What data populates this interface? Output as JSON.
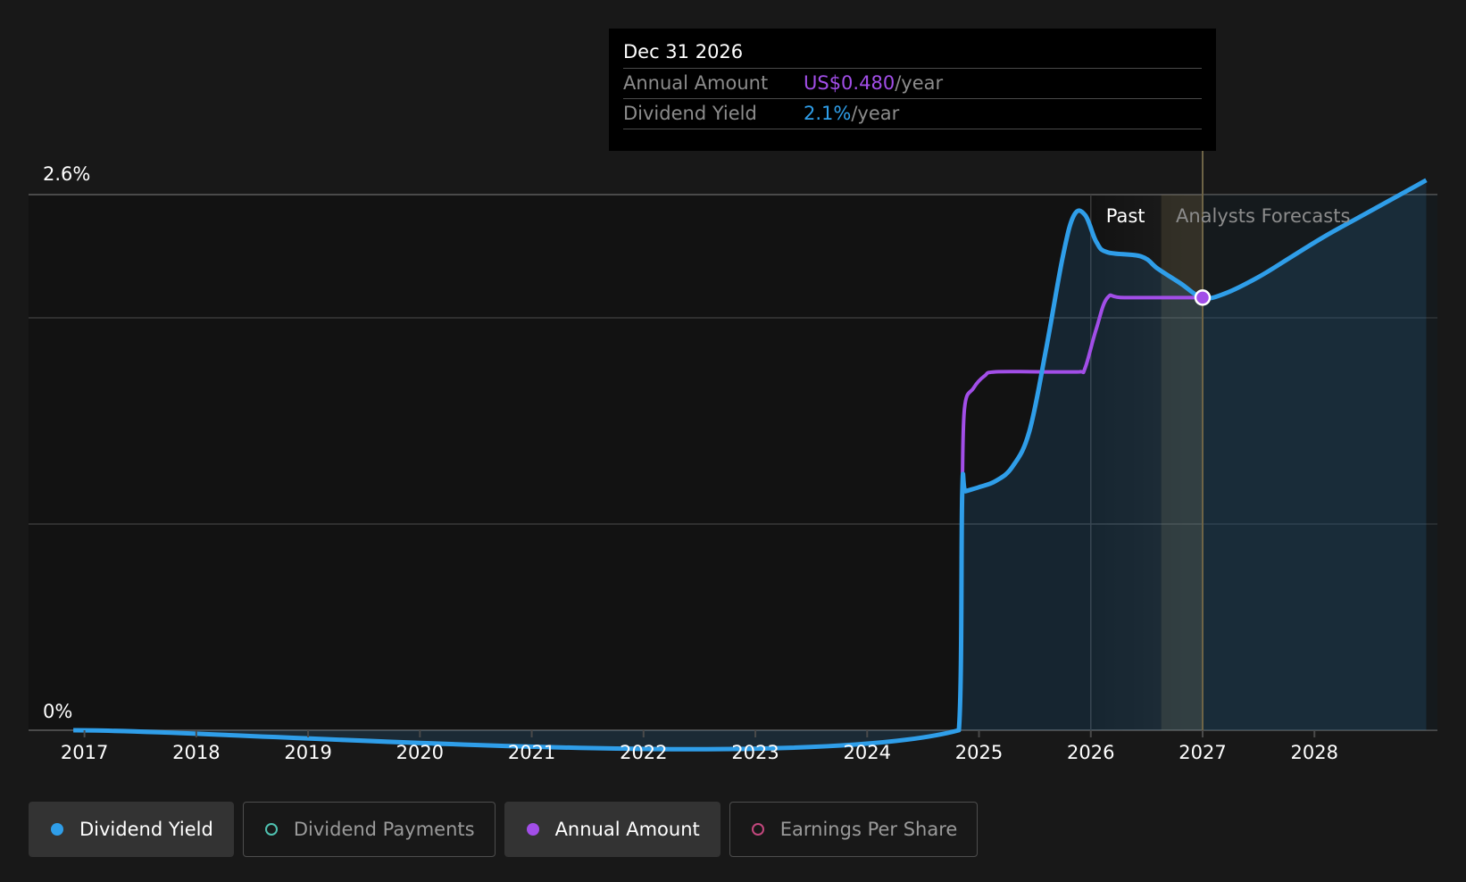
{
  "tooltip": {
    "date": "Dec 31 2026",
    "annual_label": "Annual Amount",
    "annual_value": "US$0.480",
    "annual_unit": "/year",
    "yield_label": "Dividend Yield",
    "yield_value": "2.1%",
    "yield_unit": "/year"
  },
  "legend": [
    {
      "label": "Dividend Yield",
      "color": "#2f9ee9",
      "active": true
    },
    {
      "label": "Dividend Payments",
      "color": "#4fc1b0",
      "active": false
    },
    {
      "label": "Annual Amount",
      "color": "#a24ee8",
      "active": true
    },
    {
      "label": "Earnings Per Share",
      "color": "#c2477d",
      "active": false
    }
  ],
  "colors": {
    "yield": "#2f9ee9",
    "annual": "#a24ee8",
    "background": "#181818"
  },
  "chart_data": {
    "type": "line",
    "title": "",
    "xlabel": "",
    "ylabel": "",
    "y_ticks": [
      "0%",
      "2.6%"
    ],
    "ylim": [
      0,
      2.6
    ],
    "xlim": [
      2016.5,
      2029.1
    ],
    "x_ticks": [
      "2017",
      "2018",
      "2019",
      "2020",
      "2021",
      "2022",
      "2023",
      "2024",
      "2025",
      "2026",
      "2027",
      "2028"
    ],
    "grid": true,
    "annotations": {
      "past_label": "Past",
      "forecast_label": "Analysts Forecasts",
      "past_start": 2026.0,
      "forecast_start": 2027.0
    },
    "series": [
      {
        "name": "Dividend Yield",
        "x": [
          2016.9,
          2024.82,
          2024.85,
          2024.88,
          2025.0,
          2025.15,
          2025.3,
          2025.45,
          2025.6,
          2025.75,
          2025.85,
          2025.95,
          2026.05,
          2026.15,
          2026.45,
          2026.6,
          2026.8,
          2027.0,
          2027.2,
          2027.5,
          2027.8,
          2028.1,
          2028.5,
          2028.9,
          2029.0
        ],
        "y": [
          0,
          0,
          1.15,
          1.16,
          1.18,
          1.21,
          1.28,
          1.45,
          1.85,
          2.3,
          2.5,
          2.5,
          2.37,
          2.32,
          2.3,
          2.24,
          2.17,
          2.1,
          2.12,
          2.2,
          2.3,
          2.4,
          2.52,
          2.64,
          2.67
        ]
      },
      {
        "name": "Annual Amount",
        "x": [
          2024.85,
          2024.87,
          2024.95,
          2025.05,
          2025.15,
          2025.9,
          2025.95,
          2026.05,
          2026.15,
          2026.3,
          2027.0
        ],
        "y": [
          1.13,
          1.56,
          1.66,
          1.72,
          1.74,
          1.74,
          1.76,
          1.95,
          2.1,
          2.1,
          2.1
        ]
      }
    ]
  }
}
